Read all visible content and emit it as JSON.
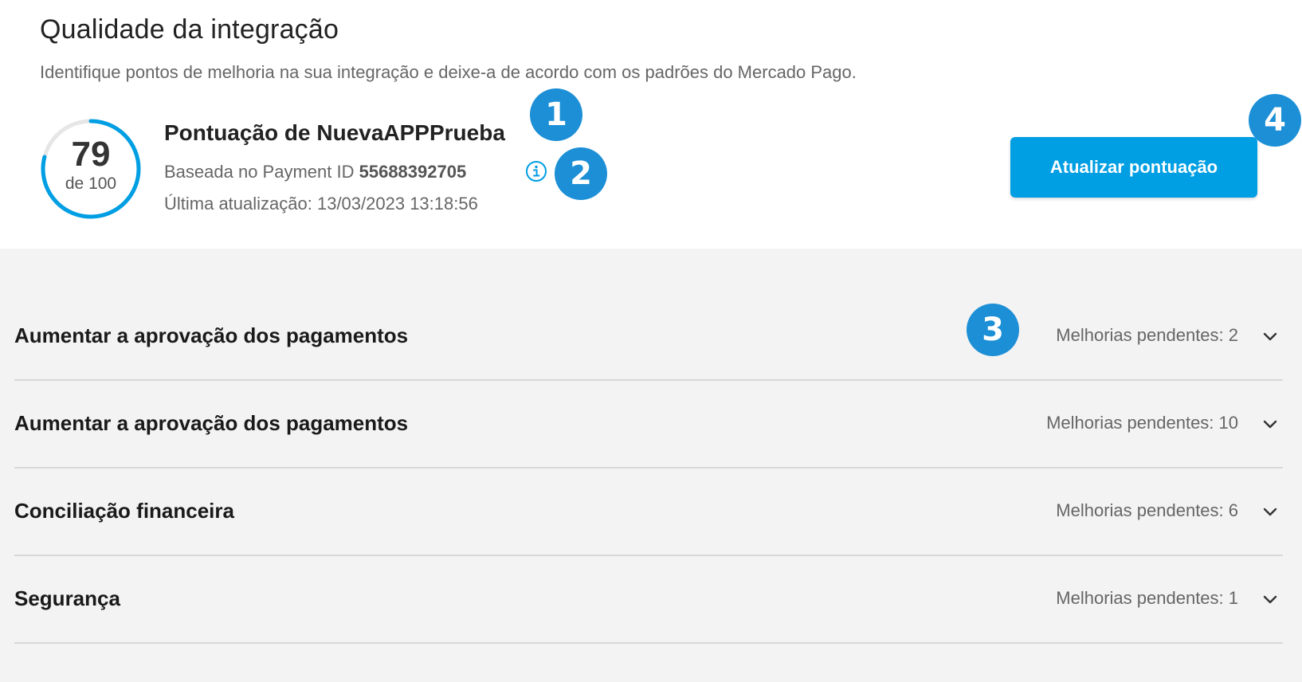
{
  "header": {
    "title": "Qualidade da integração",
    "subtitle": "Identifique pontos de melhoria na sua integração e deixe-a de acordo com os padrões do Mercado Pago."
  },
  "score": {
    "value": "79",
    "of_label": "de 100",
    "fraction": 0.79,
    "title": "Pontuação de NuevaAPPPrueba",
    "payment_prefix": "Baseada no Payment ID",
    "payment_id": "55688392705",
    "last_update": "Última atualização: 13/03/2023 13:18:56",
    "ring_color": "#009ee3",
    "track_color": "#e6e6e6"
  },
  "update_button_label": "Atualizar pontuação",
  "markers": [
    "1",
    "2",
    "3",
    "4"
  ],
  "icons": {
    "info": "info-icon",
    "chevron": "chevron-down-icon"
  },
  "accordion": [
    {
      "title": "Aumentar a aprovação dos pagamentos",
      "pending": "Melhorias pendentes: 2"
    },
    {
      "title": "Aumentar a aprovação dos pagamentos",
      "pending": "Melhorias pendentes: 10"
    },
    {
      "title": "Conciliação financeira",
      "pending": "Melhorias pendentes: 6"
    },
    {
      "title": "Segurança",
      "pending": "Melhorias pendentes: 1"
    }
  ],
  "colors": {
    "accent": "#009ee3",
    "marker": "#1c8fd6"
  }
}
